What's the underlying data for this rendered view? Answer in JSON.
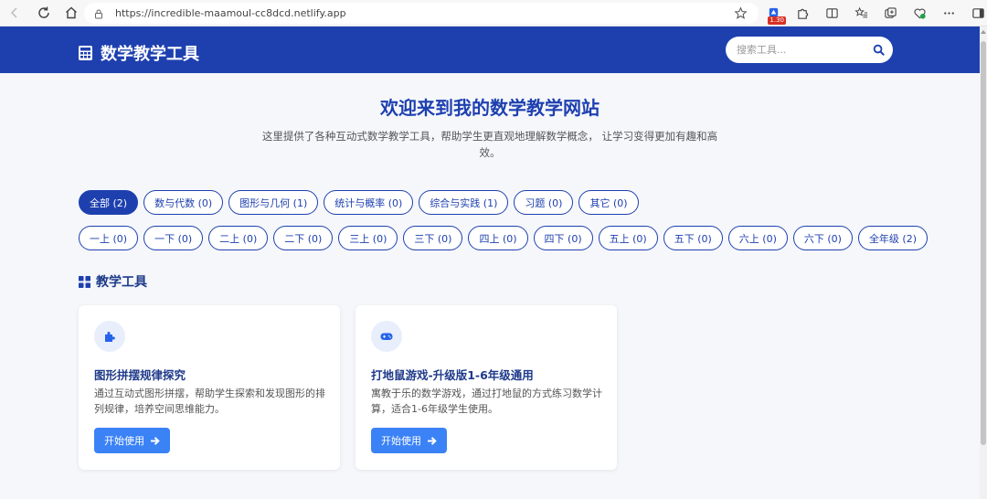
{
  "browser": {
    "url": "https://incredible-maamoul-cc8dcd.netlify.app",
    "extension_badge": "1.30"
  },
  "site": {
    "logo_text": "数学教学工具",
    "search_placeholder": "搜索工具..."
  },
  "hero": {
    "title": "欢迎来到我的数学教学网站",
    "description": "这里提供了各种互动式数学教学工具，帮助学生更直观地理解数学概念， 让学习变得更加有趣和高效。"
  },
  "filters": {
    "categories": [
      "全部 (2)",
      "数与代数 (0)",
      "图形与几何 (1)",
      "统计与概率 (0)",
      "综合与实践 (1)",
      "习题 (0)",
      "其它 (0)"
    ],
    "grades": [
      "一上 (0)",
      "一下 (0)",
      "二上 (0)",
      "二下 (0)",
      "三上 (0)",
      "三下 (0)",
      "四上 (0)",
      "四下 (0)",
      "五上 (0)",
      "五下 (0)",
      "六上 (0)",
      "六下 (0)",
      "全年级 (2)"
    ]
  },
  "section": {
    "title": "教学工具"
  },
  "cards": [
    {
      "icon": "puzzle-icon",
      "title": "图形拼摆规律探究",
      "description": "通过互动式图形拼摆，帮助学生探索和发现图形的排列规律，培养空间思维能力。",
      "button": "开始使用"
    },
    {
      "icon": "gamepad-icon",
      "title": "打地鼠游戏-升级版1-6年级通用",
      "description": "寓教于乐的数学游戏，通过打地鼠的方式练习数学计算，适合1-6年级学生使用。",
      "button": "开始使用"
    }
  ],
  "colors": {
    "primary": "#1e40af",
    "button": "#3b82f6",
    "background": "#f5f7fb"
  }
}
